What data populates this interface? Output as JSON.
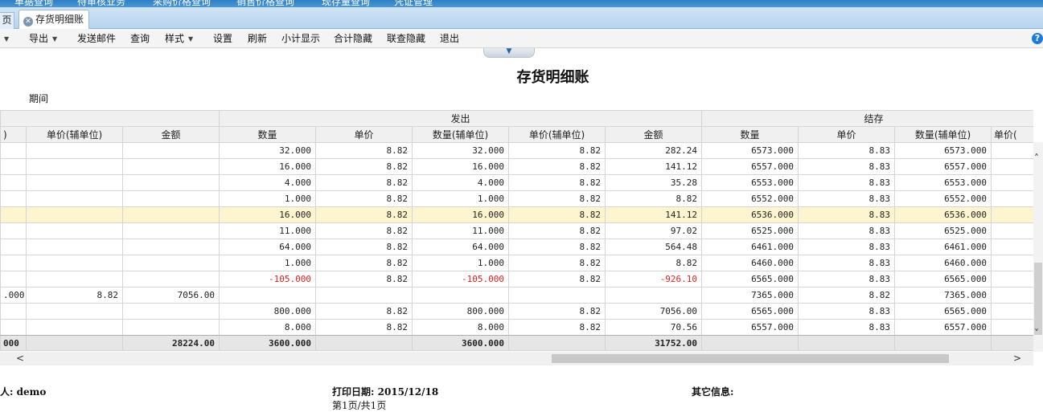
{
  "top_menu": [
    "单据查询",
    "待审核业务",
    "采购价格查询",
    "销售价格查询",
    "现存量查询",
    "凭证管理"
  ],
  "tabs": {
    "prev_label": "页",
    "active_label": "存货明细账",
    "close_symbol": "✕"
  },
  "toolbar": {
    "export_label": "导出",
    "send_mail_label": "发送邮件",
    "query_label": "查询",
    "style_label": "样式",
    "settings_label": "设置",
    "refresh_label": "刷新",
    "subtotal_label": "小计显示",
    "total_hide_label": "合计隐藏",
    "related_hide_label": "联查隐藏",
    "exit_label": "退出",
    "help_symbol": "?"
  },
  "report": {
    "title": "存货明细账",
    "period_label": "期间"
  },
  "grid": {
    "group_headers": {
      "issue": "发出",
      "balance": "结存"
    },
    "columns": [
      ")",
      "单价(辅单位)",
      "金额",
      "数量",
      "单价",
      "数量(辅单位)",
      "单价(辅单位)",
      "金额",
      "数量",
      "单价",
      "数量(辅单位)",
      "单价("
    ],
    "rows": [
      {
        "c": [
          "",
          "",
          "",
          "32.000",
          "8.82",
          "32.000",
          "8.82",
          "282.24",
          "6573.000",
          "8.83",
          "6573.000",
          ""
        ],
        "highlight": false,
        "negative": false
      },
      {
        "c": [
          "",
          "",
          "",
          "16.000",
          "8.82",
          "16.000",
          "8.82",
          "141.12",
          "6557.000",
          "8.83",
          "6557.000",
          ""
        ],
        "highlight": false,
        "negative": false
      },
      {
        "c": [
          "",
          "",
          "",
          "4.000",
          "8.82",
          "4.000",
          "8.82",
          "35.28",
          "6553.000",
          "8.83",
          "6553.000",
          ""
        ],
        "highlight": false,
        "negative": false
      },
      {
        "c": [
          "",
          "",
          "",
          "1.000",
          "8.82",
          "1.000",
          "8.82",
          "8.82",
          "6552.000",
          "8.83",
          "6552.000",
          ""
        ],
        "highlight": false,
        "negative": false
      },
      {
        "c": [
          "",
          "",
          "",
          "16.000",
          "8.82",
          "16.000",
          "8.82",
          "141.12",
          "6536.000",
          "8.83",
          "6536.000",
          ""
        ],
        "highlight": true,
        "negative": false
      },
      {
        "c": [
          "",
          "",
          "",
          "11.000",
          "8.82",
          "11.000",
          "8.82",
          "97.02",
          "6525.000",
          "8.83",
          "6525.000",
          ""
        ],
        "highlight": false,
        "negative": false
      },
      {
        "c": [
          "",
          "",
          "",
          "64.000",
          "8.82",
          "64.000",
          "8.82",
          "564.48",
          "6461.000",
          "8.83",
          "6461.000",
          ""
        ],
        "highlight": false,
        "negative": false
      },
      {
        "c": [
          "",
          "",
          "",
          "1.000",
          "8.82",
          "1.000",
          "8.82",
          "8.82",
          "6460.000",
          "8.83",
          "6460.000",
          ""
        ],
        "highlight": false,
        "negative": false
      },
      {
        "c": [
          "",
          "",
          "",
          "-105.000",
          "8.82",
          "-105.000",
          "8.82",
          "-926.10",
          "6565.000",
          "8.83",
          "6565.000",
          ""
        ],
        "highlight": false,
        "negative": true
      },
      {
        "c": [
          ".000",
          "8.82",
          "7056.00",
          "",
          "",
          "",
          "",
          "",
          "7365.000",
          "8.82",
          "7365.000",
          ""
        ],
        "highlight": false,
        "negative": false
      },
      {
        "c": [
          "",
          "",
          "",
          "800.000",
          "8.82",
          "800.000",
          "8.82",
          "7056.00",
          "6565.000",
          "8.83",
          "6565.000",
          ""
        ],
        "highlight": false,
        "negative": false
      },
      {
        "c": [
          "",
          "",
          "",
          "8.000",
          "8.82",
          "8.000",
          "8.82",
          "70.56",
          "6557.000",
          "8.83",
          "6557.000",
          ""
        ],
        "highlight": false,
        "negative": false
      }
    ],
    "totals": [
      "000",
      "",
      "28224.00",
      "3600.000",
      "",
      "3600.000",
      "",
      "31752.00",
      "",
      "",
      "",
      ""
    ]
  },
  "scroll": {
    "up": "˄",
    "down": "˅",
    "left": "<",
    "right": ">"
  },
  "footer": {
    "maker_label": "人: demo",
    "print_date_label": "打印日期: 2015/12/18",
    "page_label": "第1页/共1页",
    "other_info_label": "其它信息:"
  }
}
